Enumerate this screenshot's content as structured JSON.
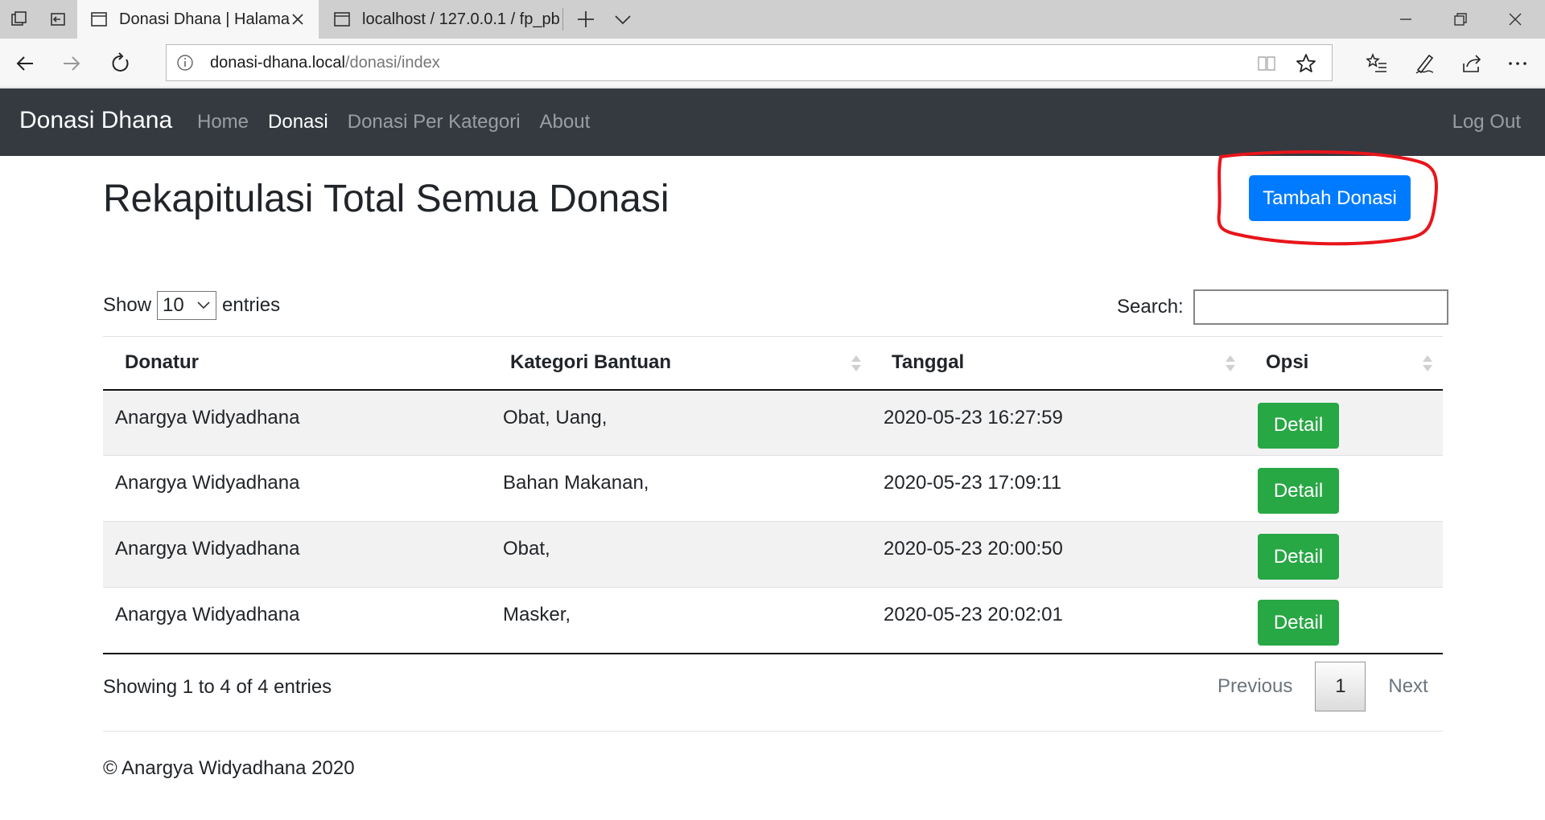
{
  "browser": {
    "tabs": [
      {
        "title": "Donasi Dhana | Halama",
        "active": true
      },
      {
        "title": "localhost / 127.0.0.1 / fp_pb",
        "active": false
      }
    ],
    "url": {
      "host": "donasi-dhana.local",
      "path": "/donasi/index"
    }
  },
  "navbar": {
    "brand": "Donasi Dhana",
    "links": [
      "Home",
      "Donasi",
      "Donasi Per Kategori",
      "About"
    ],
    "active_link": "Donasi",
    "logout": "Log Out"
  },
  "page": {
    "title": "Rekapitulasi Total Semua Donasi",
    "add_button": "Tambah Donasi",
    "annotation_color": "#e8151b"
  },
  "table_controls": {
    "show_label": "Show",
    "entries_label": "entries",
    "page_length": "10",
    "search_label": "Search:",
    "search_value": ""
  },
  "table": {
    "headers": [
      "Donatur",
      "Kategori Bantuan",
      "Tanggal",
      "Opsi"
    ],
    "rows": [
      {
        "donatur": "Anargya Widyadhana",
        "kategori": "Obat, Uang,",
        "tanggal": "2020-05-23 16:27:59",
        "opsi": "Detail"
      },
      {
        "donatur": "Anargya Widyadhana",
        "kategori": "Bahan Makanan,",
        "tanggal": "2020-05-23 17:09:11",
        "opsi": "Detail"
      },
      {
        "donatur": "Anargya Widyadhana",
        "kategori": "Obat,",
        "tanggal": "2020-05-23 20:00:50",
        "opsi": "Detail"
      },
      {
        "donatur": "Anargya Widyadhana",
        "kategori": "Masker,",
        "tanggal": "2020-05-23 20:02:01",
        "opsi": "Detail"
      }
    ]
  },
  "pagination": {
    "info": "Showing 1 to 4 of 4 entries",
    "previous": "Previous",
    "current": "1",
    "next": "Next"
  },
  "footer": {
    "text": "© Anargya Widyadhana 2020"
  },
  "colors": {
    "navbar": "#343a40",
    "primary": "#007bff",
    "success": "#28a745"
  }
}
